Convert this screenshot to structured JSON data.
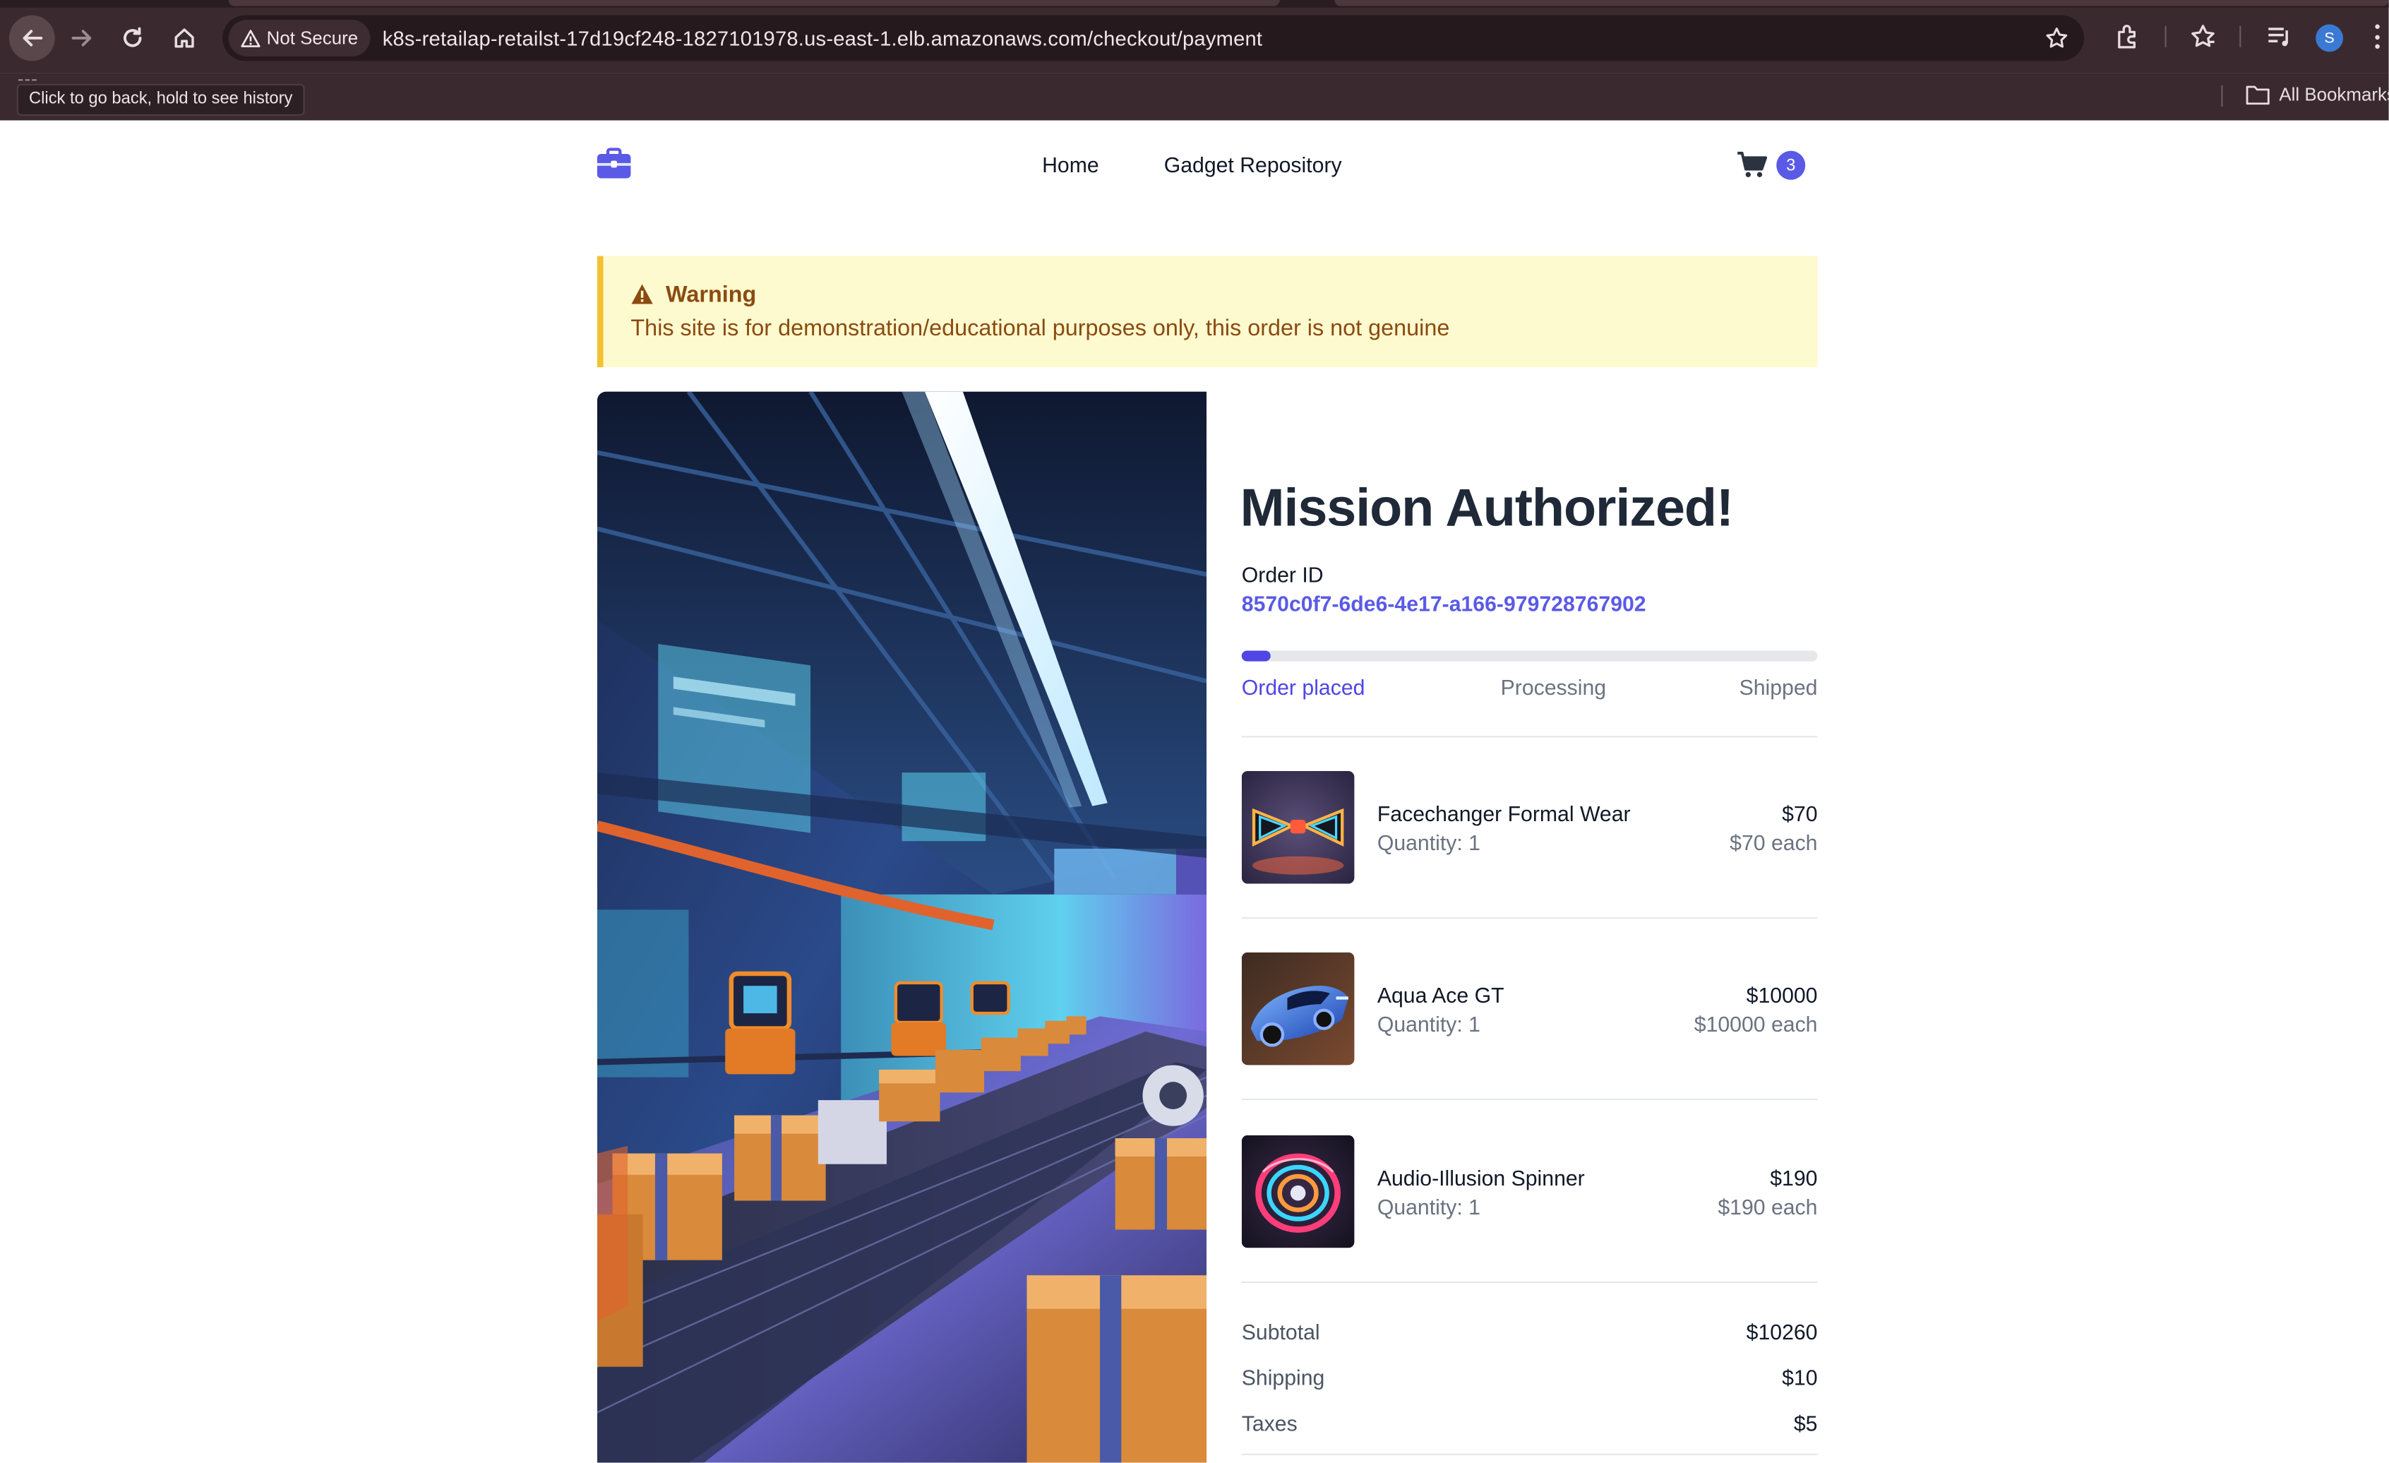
{
  "browser": {
    "security_label": "Not Secure",
    "url": "k8s-retailap-retailst-17d19cf248-1827101978.us-east-1.elb.amazonaws.com/checkout/payment",
    "tooltip": "Click to go back, hold to see history",
    "all_bookmarks": "All Bookmarks",
    "profile_initial": "S"
  },
  "header": {
    "nav": [
      "Home",
      "Gadget Repository"
    ],
    "cart_count": "3",
    "brand_color": "#5a5ae6"
  },
  "warning": {
    "title": "Warning",
    "text": "This site is for demonstration/educational purposes only, this order is not genuine"
  },
  "confirmation": {
    "title": "Mission Authorized!",
    "order_id_label": "Order ID",
    "order_id": "8570c0f7-6de6-4e17-a166-979728767902",
    "progress": 0.05,
    "steps": [
      "Order placed",
      "Processing",
      "Shipped"
    ],
    "current_step": "Order placed"
  },
  "items": [
    {
      "name": "Facechanger Formal Wear",
      "quantity": "Quantity: 1",
      "price": "$70",
      "each": "$70 each",
      "icon": "bowtie-image"
    },
    {
      "name": "Aqua Ace GT",
      "quantity": "Quantity: 1",
      "price": "$10000",
      "each": "$10000 each",
      "icon": "sports-car-image"
    },
    {
      "name": "Audio-Illusion Spinner",
      "quantity": "Quantity: 1",
      "price": "$190",
      "each": "$190 each",
      "icon": "spinner-image"
    }
  ],
  "summary": {
    "subtotal_label": "Subtotal",
    "subtotal": "$10260",
    "shipping_label": "Shipping",
    "shipping": "$10",
    "taxes_label": "Taxes",
    "taxes": "$5"
  },
  "colors": {
    "chrome": "#3a2a2f",
    "warning_bg": "#fefacf",
    "warning_text": "#8a4b12",
    "accent": "#4f46e5"
  }
}
